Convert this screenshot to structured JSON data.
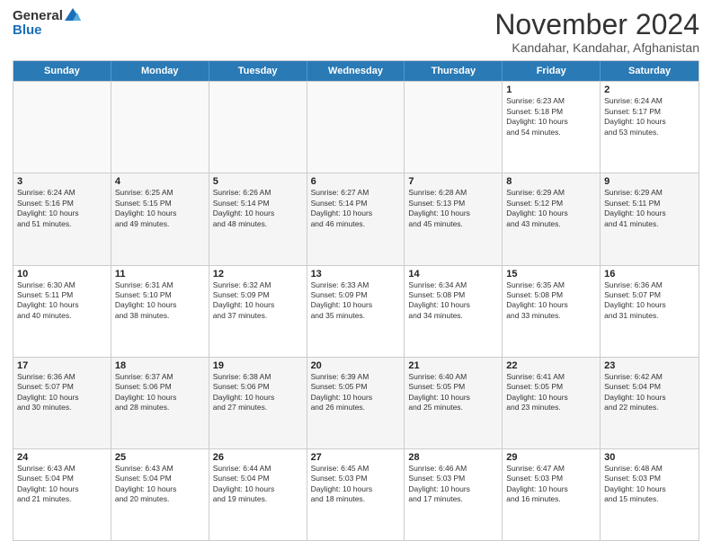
{
  "logo": {
    "general": "General",
    "blue": "Blue"
  },
  "header": {
    "month": "November 2024",
    "location": "Kandahar, Kandahar, Afghanistan"
  },
  "weekdays": [
    "Sunday",
    "Monday",
    "Tuesday",
    "Wednesday",
    "Thursday",
    "Friday",
    "Saturday"
  ],
  "rows": [
    {
      "cells": [
        {
          "empty": true
        },
        {
          "empty": true
        },
        {
          "empty": true
        },
        {
          "empty": true
        },
        {
          "empty": true
        },
        {
          "day": 1,
          "info": "Sunrise: 6:23 AM\nSunset: 5:18 PM\nDaylight: 10 hours\nand 54 minutes."
        },
        {
          "day": 2,
          "info": "Sunrise: 6:24 AM\nSunset: 5:17 PM\nDaylight: 10 hours\nand 53 minutes."
        }
      ]
    },
    {
      "cells": [
        {
          "day": 3,
          "info": "Sunrise: 6:24 AM\nSunset: 5:16 PM\nDaylight: 10 hours\nand 51 minutes."
        },
        {
          "day": 4,
          "info": "Sunrise: 6:25 AM\nSunset: 5:15 PM\nDaylight: 10 hours\nand 49 minutes."
        },
        {
          "day": 5,
          "info": "Sunrise: 6:26 AM\nSunset: 5:14 PM\nDaylight: 10 hours\nand 48 minutes."
        },
        {
          "day": 6,
          "info": "Sunrise: 6:27 AM\nSunset: 5:14 PM\nDaylight: 10 hours\nand 46 minutes."
        },
        {
          "day": 7,
          "info": "Sunrise: 6:28 AM\nSunset: 5:13 PM\nDaylight: 10 hours\nand 45 minutes."
        },
        {
          "day": 8,
          "info": "Sunrise: 6:29 AM\nSunset: 5:12 PM\nDaylight: 10 hours\nand 43 minutes."
        },
        {
          "day": 9,
          "info": "Sunrise: 6:29 AM\nSunset: 5:11 PM\nDaylight: 10 hours\nand 41 minutes."
        }
      ]
    },
    {
      "cells": [
        {
          "day": 10,
          "info": "Sunrise: 6:30 AM\nSunset: 5:11 PM\nDaylight: 10 hours\nand 40 minutes."
        },
        {
          "day": 11,
          "info": "Sunrise: 6:31 AM\nSunset: 5:10 PM\nDaylight: 10 hours\nand 38 minutes."
        },
        {
          "day": 12,
          "info": "Sunrise: 6:32 AM\nSunset: 5:09 PM\nDaylight: 10 hours\nand 37 minutes."
        },
        {
          "day": 13,
          "info": "Sunrise: 6:33 AM\nSunset: 5:09 PM\nDaylight: 10 hours\nand 35 minutes."
        },
        {
          "day": 14,
          "info": "Sunrise: 6:34 AM\nSunset: 5:08 PM\nDaylight: 10 hours\nand 34 minutes."
        },
        {
          "day": 15,
          "info": "Sunrise: 6:35 AM\nSunset: 5:08 PM\nDaylight: 10 hours\nand 33 minutes."
        },
        {
          "day": 16,
          "info": "Sunrise: 6:36 AM\nSunset: 5:07 PM\nDaylight: 10 hours\nand 31 minutes."
        }
      ]
    },
    {
      "cells": [
        {
          "day": 17,
          "info": "Sunrise: 6:36 AM\nSunset: 5:07 PM\nDaylight: 10 hours\nand 30 minutes."
        },
        {
          "day": 18,
          "info": "Sunrise: 6:37 AM\nSunset: 5:06 PM\nDaylight: 10 hours\nand 28 minutes."
        },
        {
          "day": 19,
          "info": "Sunrise: 6:38 AM\nSunset: 5:06 PM\nDaylight: 10 hours\nand 27 minutes."
        },
        {
          "day": 20,
          "info": "Sunrise: 6:39 AM\nSunset: 5:05 PM\nDaylight: 10 hours\nand 26 minutes."
        },
        {
          "day": 21,
          "info": "Sunrise: 6:40 AM\nSunset: 5:05 PM\nDaylight: 10 hours\nand 25 minutes."
        },
        {
          "day": 22,
          "info": "Sunrise: 6:41 AM\nSunset: 5:05 PM\nDaylight: 10 hours\nand 23 minutes."
        },
        {
          "day": 23,
          "info": "Sunrise: 6:42 AM\nSunset: 5:04 PM\nDaylight: 10 hours\nand 22 minutes."
        }
      ]
    },
    {
      "cells": [
        {
          "day": 24,
          "info": "Sunrise: 6:43 AM\nSunset: 5:04 PM\nDaylight: 10 hours\nand 21 minutes."
        },
        {
          "day": 25,
          "info": "Sunrise: 6:43 AM\nSunset: 5:04 PM\nDaylight: 10 hours\nand 20 minutes."
        },
        {
          "day": 26,
          "info": "Sunrise: 6:44 AM\nSunset: 5:04 PM\nDaylight: 10 hours\nand 19 minutes."
        },
        {
          "day": 27,
          "info": "Sunrise: 6:45 AM\nSunset: 5:03 PM\nDaylight: 10 hours\nand 18 minutes."
        },
        {
          "day": 28,
          "info": "Sunrise: 6:46 AM\nSunset: 5:03 PM\nDaylight: 10 hours\nand 17 minutes."
        },
        {
          "day": 29,
          "info": "Sunrise: 6:47 AM\nSunset: 5:03 PM\nDaylight: 10 hours\nand 16 minutes."
        },
        {
          "day": 30,
          "info": "Sunrise: 6:48 AM\nSunset: 5:03 PM\nDaylight: 10 hours\nand 15 minutes."
        }
      ]
    }
  ]
}
